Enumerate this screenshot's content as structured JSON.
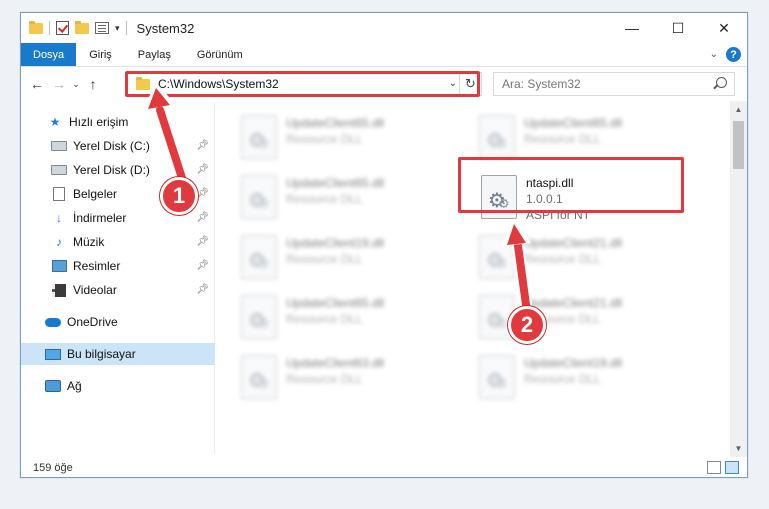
{
  "window": {
    "title": "System32",
    "controls": {
      "minimize": "—",
      "maximize": "☐",
      "close": "✕"
    }
  },
  "ribbon": {
    "tabs": [
      {
        "label": "Dosya"
      },
      {
        "label": "Giriş"
      },
      {
        "label": "Paylaş"
      },
      {
        "label": "Görünüm"
      }
    ],
    "help": "?"
  },
  "navigation": {
    "address": "C:\\Windows\\System32",
    "search_placeholder": "Ara: System32"
  },
  "nav_pane": {
    "items": [
      {
        "label": "Hızlı erişim",
        "icon": "star-icon"
      },
      {
        "label": "Yerel Disk (C:)",
        "icon": "drive-icon",
        "pinned": true
      },
      {
        "label": "Yerel Disk (D:)",
        "icon": "drive-icon",
        "pinned": true
      },
      {
        "label": "Belgeler",
        "icon": "documents-icon",
        "pinned": true
      },
      {
        "label": "İndirmeler",
        "icon": "download-icon",
        "pinned": true
      },
      {
        "label": "Müzik",
        "icon": "music-icon",
        "pinned": true
      },
      {
        "label": "Resimler",
        "icon": "pictures-icon",
        "pinned": true
      },
      {
        "label": "Videolar",
        "icon": "videos-icon",
        "pinned": true
      },
      {
        "label": "OneDrive",
        "icon": "cloud-icon"
      },
      {
        "label": "Bu bilgisayar",
        "icon": "computer-icon",
        "selected": true
      },
      {
        "label": "Ağ",
        "icon": "network-icon"
      }
    ]
  },
  "files": [
    {
      "name": "UpdateClient65.dll",
      "type": "Resource DLL",
      "blurred": true
    },
    {
      "name": "UpdateClient65.dll",
      "type": "Resource DLL",
      "blurred": true
    },
    {
      "name": "UpdateClient65.dll",
      "type": "Resource DLL",
      "blurred": true
    },
    {
      "name": "ntaspi.dll",
      "version": "1.0.0.1",
      "description": "ASPI for NT",
      "highlighted": true
    },
    {
      "name": "UpdateClient19.dll",
      "type": "Resource DLL",
      "blurred": true
    },
    {
      "name": "UpdateClient21.dll",
      "type": "Resource DLL",
      "blurred": true
    },
    {
      "name": "UpdateClient65.dll",
      "type": "Resource DLL",
      "blurred": true
    },
    {
      "name": "UpdateClient21.dll",
      "type": "Resource DLL",
      "blurred": true
    },
    {
      "name": "UpdateClient63.dll",
      "type": "Resource DLL",
      "blurred": true
    },
    {
      "name": "UpdateClient19.dll",
      "type": "Resource DLL",
      "blurred": true
    }
  ],
  "status": {
    "item_count": "159 öğe"
  },
  "callouts": {
    "step1": "1",
    "step2": "2"
  },
  "colors": {
    "accent": "#1979ca",
    "highlight": "#e0393e",
    "selected": "#cce4f7"
  }
}
